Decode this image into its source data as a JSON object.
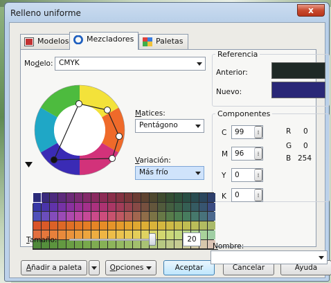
{
  "window": {
    "title": "Relleno uniforme",
    "close_glyph": "x"
  },
  "tabs": [
    {
      "label": "Modelos",
      "icon": "models-icon",
      "active": false
    },
    {
      "label": "Mezcladores",
      "icon": "mixers-icon",
      "active": true
    },
    {
      "label": "Paletas",
      "icon": "palettes-icon",
      "active": false
    }
  ],
  "model": {
    "label_pre": "Mo",
    "label_ul": "d",
    "label_post": "elo:",
    "value": "CMYK"
  },
  "harmonies": {
    "label_ul": "M",
    "label_post": "atices:",
    "value": "Pentágono"
  },
  "variation": {
    "label_ul": "V",
    "label_post": "ariación:",
    "value": "Más frío"
  },
  "reference": {
    "title": "Referencia",
    "old_label": "Anterior:",
    "old_color": "#1f2926",
    "new_label": "Nuevo:",
    "new_color": "#2a2877"
  },
  "components": {
    "title": "Componentes",
    "cmyk": [
      {
        "name": "C",
        "value": "99"
      },
      {
        "name": "M",
        "value": "96"
      },
      {
        "name": "Y",
        "value": "0"
      },
      {
        "name": "K",
        "value": "0"
      }
    ],
    "rgb": [
      {
        "name": "R",
        "value": "0"
      },
      {
        "name": "G",
        "value": "0"
      },
      {
        "name": "B",
        "value": "254"
      }
    ],
    "spin_glyph": "⁞"
  },
  "name_field": {
    "label_ul": "N",
    "label_post": "ombre:",
    "value": ""
  },
  "size": {
    "label_ul": "T",
    "label_post": "amaño:",
    "value": "20",
    "slider_fraction": 0.95
  },
  "buttons": {
    "add_palette": {
      "label_ul": "A",
      "label_post": "ñadir a paleta"
    },
    "options": {
      "label_ul": "O",
      "label_post": "pciones"
    },
    "accept": "Aceptar",
    "cancel": "Cancelar",
    "help": "Ayuda"
  },
  "colors": {
    "accent": "#3c7fb1",
    "selected_field": "#cfe3fb",
    "grid_rows": [
      [
        "#2b2b7a",
        "#3a2a7d",
        "#4c2a7e",
        "#5d2a7c",
        "#6d2a78",
        "#7a2a72",
        "#842a6a",
        "#8a2a60",
        "#8c2b55",
        "#8a2e4a",
        "#843242",
        "#7a373a",
        "#6c3c34",
        "#5d4230",
        "#4d472e",
        "#3f4b2f",
        "#334e33",
        "#2c4f3a",
        "#284e44",
        "#284b50",
        "#2a465d",
        "#2d3f6b"
      ],
      [
        "#3636a6",
        "#4a34aa",
        "#6133aa",
        "#7632a6",
        "#8a319f",
        "#9a3096",
        "#a4308b",
        "#ab317e",
        "#ad3372",
        "#aa3765",
        "#a23d59",
        "#97434f",
        "#884a46",
        "#76503f",
        "#63563c",
        "#515b3c",
        "#435f40",
        "#3a6148",
        "#355f54",
        "#355b62",
        "#375570",
        "#3b4c82"
      ],
      [
        "#5151b9",
        "#6b4ebc",
        "#844cbb",
        "#9b4ab6",
        "#ae49ae",
        "#bd48a3",
        "#c64997",
        "#cb4a8a",
        "#cc4d7c",
        "#c8526e",
        "#bf5862",
        "#b25f58",
        "#a2664f",
        "#8f6d49",
        "#7b7346",
        "#677846",
        "#577c4a",
        "#4d7e52",
        "#477c5e",
        "#46786c",
        "#48727b",
        "#4c698e"
      ],
      [
        "#d9542a",
        "#da5a28",
        "#dc6127",
        "#de6826",
        "#e06f25",
        "#e27625",
        "#e47d25",
        "#e58526",
        "#e68c27",
        "#e69429",
        "#e59b2b",
        "#e3a22e",
        "#e0a831",
        "#ddae35",
        "#d9b33a",
        "#d4b73f",
        "#ceba45",
        "#c8bc4b",
        "#c1bd52",
        "#babd59",
        "#b2bc61",
        "#aaba69"
      ],
      [
        "#e36f3e",
        "#e5773c",
        "#e7803b",
        "#e98a3b",
        "#eb933b",
        "#ec9c3c",
        "#eda53e",
        "#eead41",
        "#eeb544",
        "#edbd48",
        "#ebc34d",
        "#e8c953",
        "#e4ce59",
        "#dfd260",
        "#d9d567",
        "#d2d76f",
        "#cbd877",
        "#c3d880",
        "#bbd789",
        "#b2d592",
        "#a9d29b",
        "#a0cfa4"
      ],
      [
        "#4f8a3a",
        "#558f3c",
        "#5c943e",
        "#639941",
        "#6a9e44",
        "#71a348",
        "#78a84c",
        "#7fac51",
        "#86b156",
        "#8db55b",
        "#94b961",
        "#9bbd67",
        "#a2c06d",
        "#a9c374",
        "#b0c67b",
        "#b7c882",
        "#bec98a",
        "#c5cb92",
        "#ccca9a",
        "#d2c9a3",
        "#d7c7ac",
        "#dbc4b5"
      ]
    ]
  }
}
